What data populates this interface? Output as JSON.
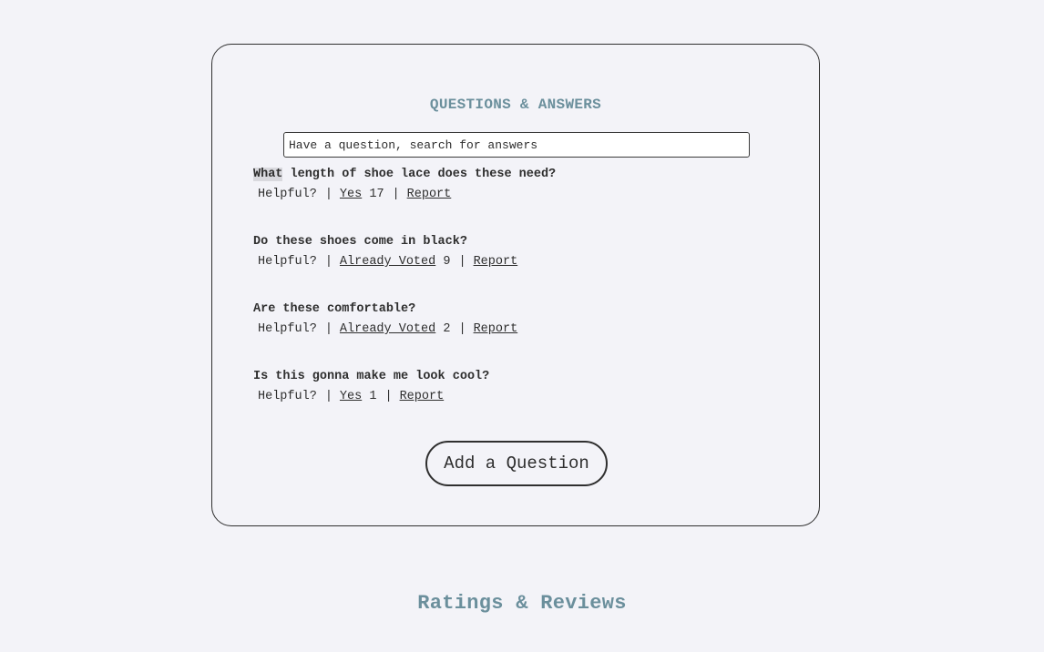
{
  "qa": {
    "title": "QUESTIONS & ANSWERS",
    "search_placeholder": "Have a question, search for answers",
    "questions": [
      {
        "text_highlight": "What",
        "text_rest": " length of shoe lace does these need?",
        "helpful_label": "Helpful?",
        "vote_label": "Yes",
        "count": "17",
        "report_label": "Report"
      },
      {
        "text": "Do these shoes come in black?",
        "helpful_label": "Helpful?",
        "vote_label": "Already Voted",
        "count": "9",
        "report_label": "Report"
      },
      {
        "text": "Are these comfortable?",
        "helpful_label": "Helpful?",
        "vote_label": "Already Voted",
        "count": "2",
        "report_label": "Report"
      },
      {
        "text": "Is this gonna make me look cool?",
        "helpful_label": "Helpful?",
        "vote_label": "Yes",
        "count": "1",
        "report_label": "Report"
      }
    ],
    "add_question_label": "Add a Question",
    "separator": "|"
  },
  "reviews": {
    "title": "Ratings & Reviews"
  }
}
